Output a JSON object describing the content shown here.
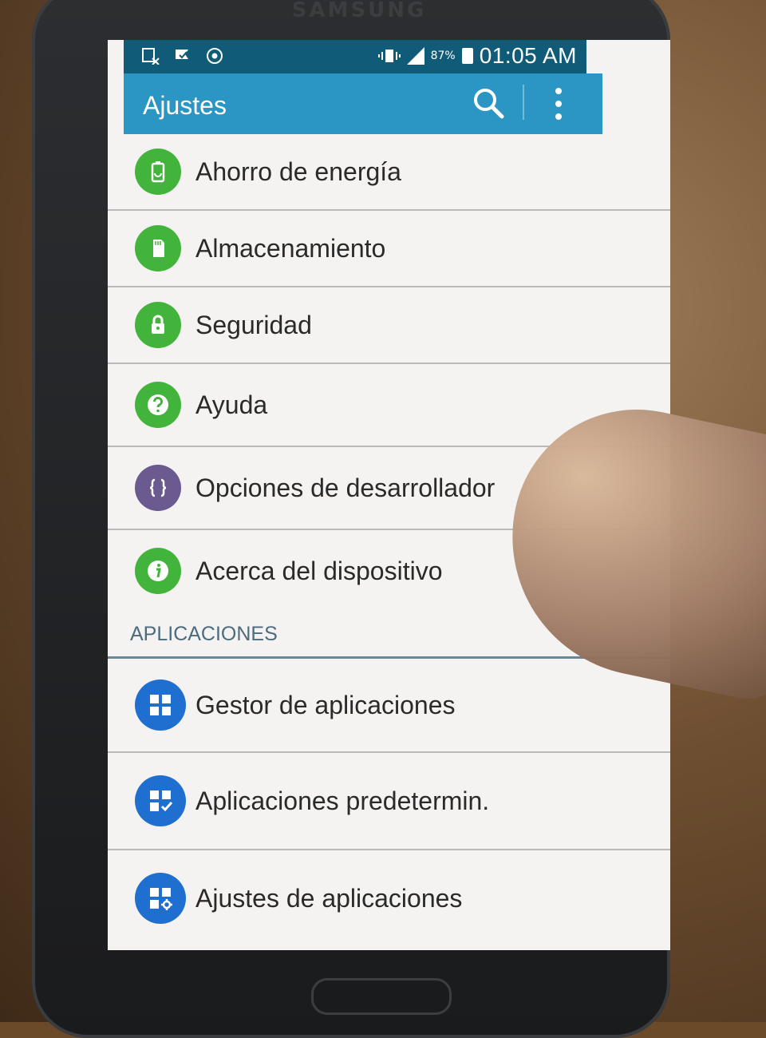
{
  "device": {
    "brand": "SAMSUNG"
  },
  "status_bar": {
    "battery": "87%",
    "time": "01:05 AM",
    "left_icons": [
      "storage-notification-icon",
      "flag-check-icon",
      "chrome-icon"
    ],
    "right_icons": [
      "vibrate-icon",
      "signal-icon",
      "battery-icon"
    ]
  },
  "app_bar": {
    "title": "Ajustes",
    "color": "#2b95c4",
    "actions": [
      "search-icon",
      "more-options-icon"
    ]
  },
  "settings": {
    "items": [
      {
        "label": "Ahorro de energía",
        "icon": "battery-saver-icon",
        "color": "#42b43b"
      },
      {
        "label": "Almacenamiento",
        "icon": "sd-card-icon",
        "color": "#42b43b"
      },
      {
        "label": "Seguridad",
        "icon": "lock-icon",
        "color": "#42b43b"
      },
      {
        "label": "Ayuda",
        "icon": "help-icon",
        "color": "#42b43b"
      },
      {
        "label": "Opciones de desarrollador",
        "icon": "braces-icon",
        "color": "#6b5a8f"
      },
      {
        "label": "Acerca del dispositivo",
        "icon": "info-icon",
        "color": "#42b43b"
      }
    ]
  },
  "applications": {
    "header": "APLICACIONES",
    "items": [
      {
        "label": "Gestor de aplicaciones",
        "icon": "app-grid-icon",
        "color": "#1f6fd1"
      },
      {
        "label": "Aplicaciones predetermin.",
        "icon": "app-grid-check-icon",
        "color": "#1f6fd1"
      },
      {
        "label": "Ajustes de aplicaciones",
        "icon": "app-grid-gear-icon",
        "color": "#1f6fd1"
      }
    ]
  }
}
